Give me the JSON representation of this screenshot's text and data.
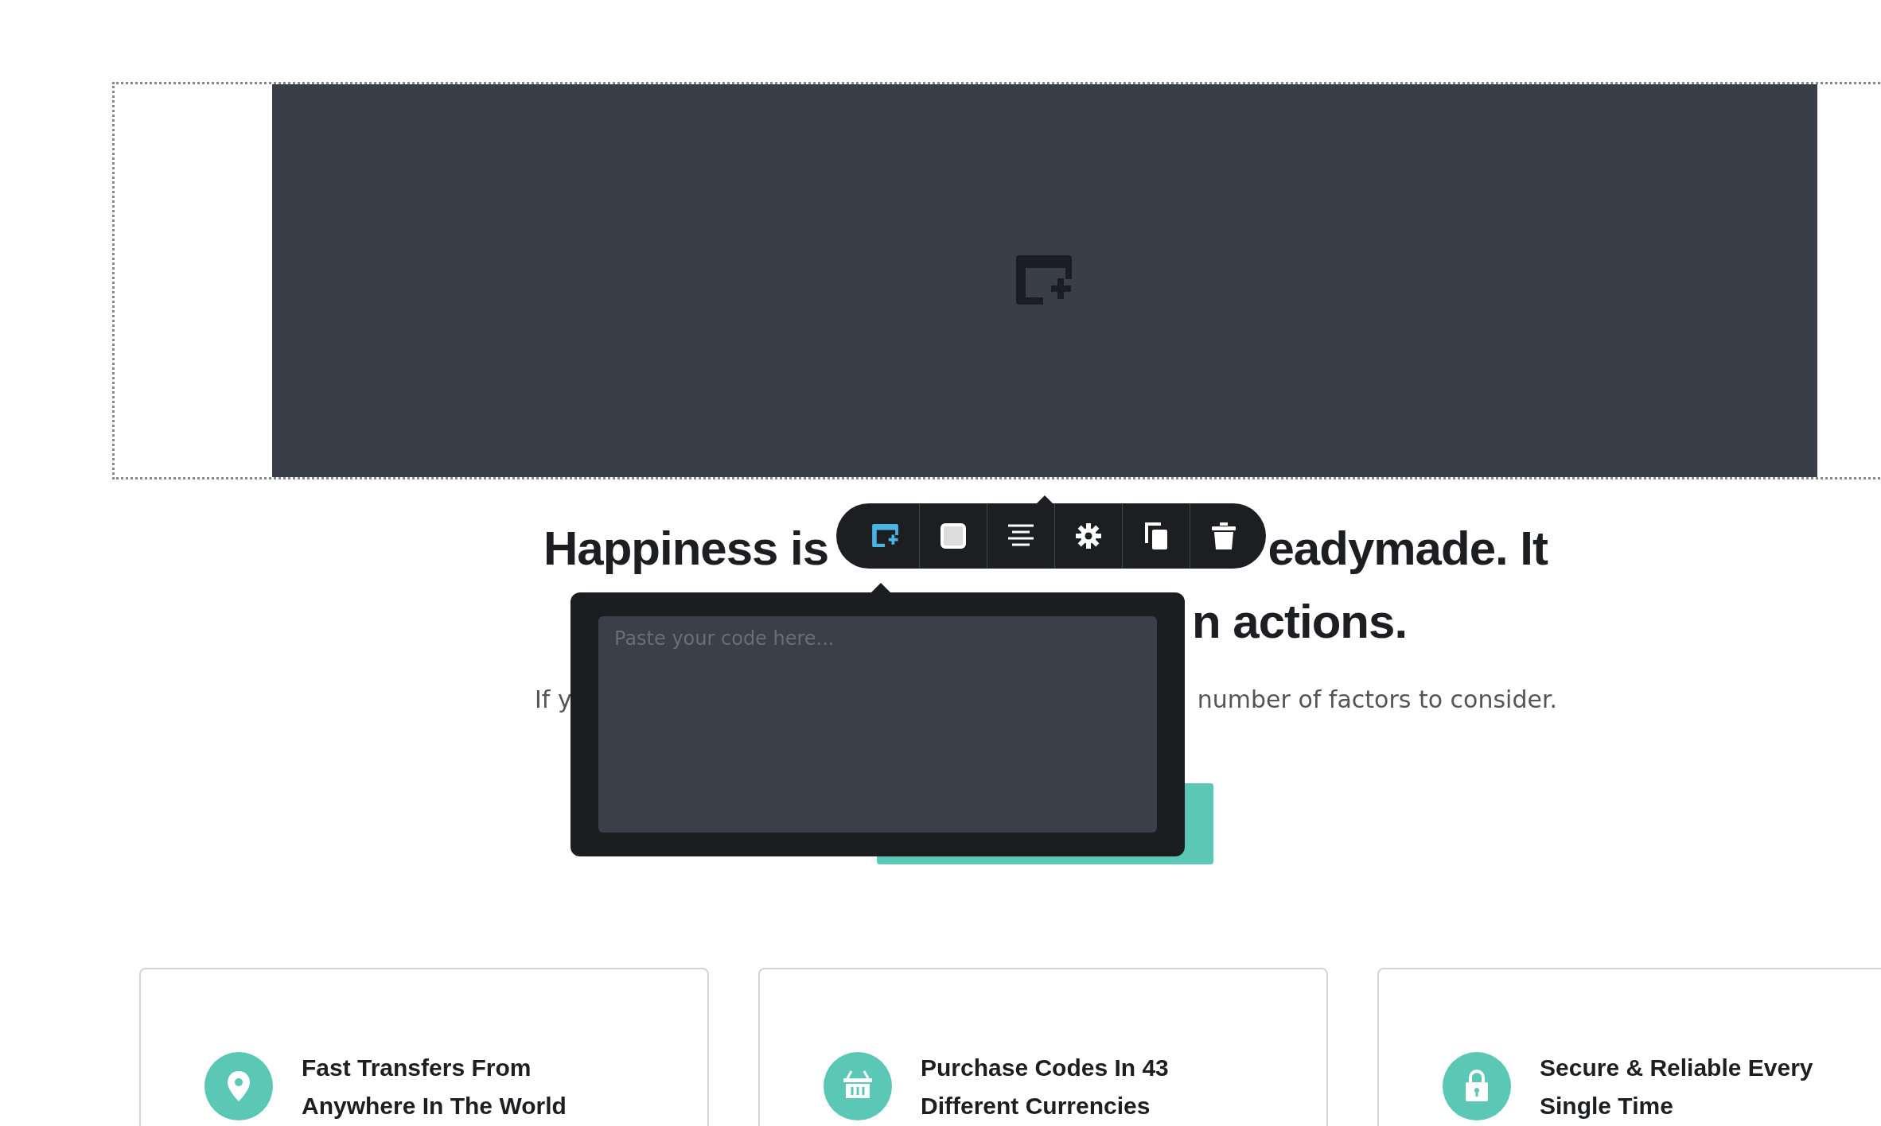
{
  "heading": {
    "line_1_start": "Happiness is",
    "line_1_end": "eadymade. It",
    "line_2_end": "n actions."
  },
  "paragraph": {
    "start": "If y",
    "end": "number of factors to consider."
  },
  "toolbar": [
    {
      "kind": "add-section",
      "selected": true
    },
    {
      "kind": "square",
      "selected": false
    },
    {
      "kind": "align",
      "selected": false
    },
    {
      "kind": "settings",
      "selected": false
    },
    {
      "kind": "duplicate",
      "selected": false
    },
    {
      "kind": "delete",
      "selected": false
    }
  ],
  "code_popup": {
    "placeholder": "Paste your code here..."
  },
  "cards": [
    {
      "kind": "pin",
      "title": "Fast Transfers From Anywhere In The World"
    },
    {
      "kind": "basket",
      "title": "Purchase Codes In 43 Different Currencies"
    },
    {
      "kind": "lock",
      "title": "Secure & Reliable Every Single Time"
    }
  ]
}
